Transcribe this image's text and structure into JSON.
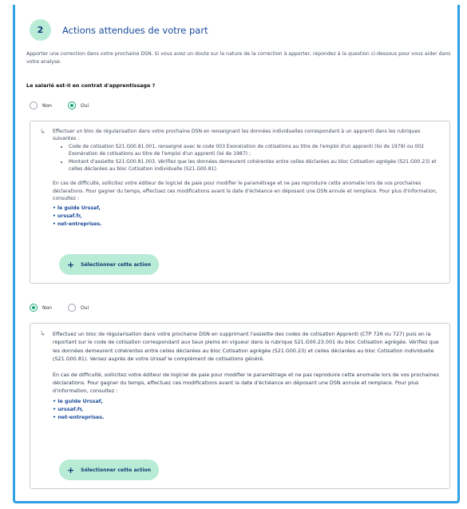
{
  "step": {
    "number": "2",
    "title": "Actions attendues de votre part"
  },
  "intro": "Apporter une correction dans votre prochaine DSN. Si vous avez un doute sur la nature de la correction à apporter, répondez à la question ci-dessous pour vous aider dans votre analyse.",
  "question": "Le salarié est-il en contrat d'apprentissage ?",
  "options": {
    "non": "Non",
    "oui": "Oui"
  },
  "selected_top": "oui",
  "card_yes": {
    "text1": "Effectuer un bloc de régularisation dans votre prochaine DSN en renseignant les données individuelles correspondant à un apprenti dans les rubriques suivantes :",
    "bullets": [
      "Code de cotisation S21.G00.81.001, renseigné avec le code 003 Exonération de cotisations au titre de l'emploi d'un apprenti (loi de 1979) ou 002 Exonération de cotisations au titre de l'emploi d'un apprenti (loi de 1987) ;",
      "Montant d'assiette S21.G00.81.003. Vérifiez que les données demeurent cohérentes entre celles déclarées au bloc Cotisation agrégée (S21.G00.23) et celles déclarées au bloc Cotisation individuelle (S21.G00.81)."
    ],
    "text2": "En cas de difficulté, sollicitez votre éditeur de logiciel de paie pour modifier le paramétrage et ne pas reproduire cette anomalie lors de vos prochaines déclarations. Pour gagner du temps, effectuez ces modifications avant la date d'échéance en déposant une DSN annule et remplace. Pour plus d'information, consultez :",
    "links": [
      "le guide Urssaf,",
      "urssaf.fr,",
      "net-entreprises."
    ],
    "button": "Sélectionner cette action"
  },
  "selected_bottom": "non",
  "card_no": {
    "text1": "Effectuez un bloc de régularisation dans votre prochaine DSN en supprimant l'assiette des codes de cotisation Apprenti (CTP 726 ou 727) puis en la reportant sur le code de cotisation correspondant aux taux pleins en vigueur dans la rubrique S21.G00.23.001 du bloc Cotisation agrégée. Vérifiez que les données demeurent cohérentes entre celles déclarées au bloc Cotisation agrégée (S21.G00.23) et celles déclarées au bloc Cotisation individuelle (S21.G00.81). Versez auprès de votre Urssaf le complément de cotisations généré.",
    "text2": "En cas de difficulté, sollicitez votre éditeur de logiciel de paie pour modifier le paramétrage et ne pas reproduire cette anomalie lors de vos prochaines déclarations. Pour gagner du temps, effectuez ces modifications avant la date d'échéance en déposant une DSN annule et remplace. Pour plus d'information, consultez :",
    "links": [
      "le guide Urssaf,",
      "urssaf.fr,",
      "net-entreprises."
    ],
    "button": "Sélectionner cette action"
  },
  "colors": {
    "frame": "#2f9fe6",
    "accent_green": "#b9ecd6",
    "radio_green": "#17a672",
    "link_blue": "#1b4b9a"
  }
}
